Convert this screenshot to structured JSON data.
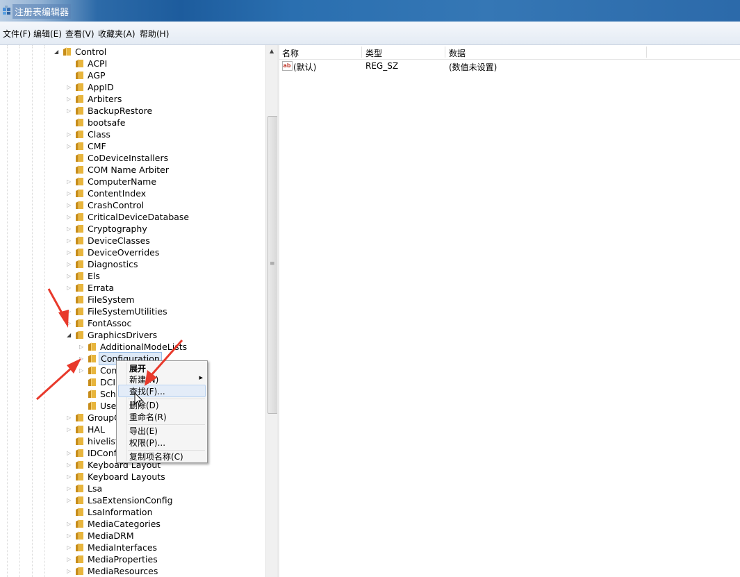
{
  "window": {
    "title": "注册表编辑器"
  },
  "menu": [
    "文件(F)",
    "编辑(E)",
    "查看(V)",
    "收藏夹(A)",
    "帮助(H)"
  ],
  "tree": {
    "rows": [
      {
        "label": "Control",
        "level": 0,
        "expander": "open"
      },
      {
        "label": "ACPI",
        "level": 1,
        "expander": "none"
      },
      {
        "label": "AGP",
        "level": 1,
        "expander": "none"
      },
      {
        "label": "AppID",
        "level": 1,
        "expander": "closed"
      },
      {
        "label": "Arbiters",
        "level": 1,
        "expander": "closed"
      },
      {
        "label": "BackupRestore",
        "level": 1,
        "expander": "closed"
      },
      {
        "label": "bootsafe",
        "level": 1,
        "expander": "none"
      },
      {
        "label": "Class",
        "level": 1,
        "expander": "closed"
      },
      {
        "label": "CMF",
        "level": 1,
        "expander": "closed"
      },
      {
        "label": "CoDeviceInstallers",
        "level": 1,
        "expander": "none"
      },
      {
        "label": "COM Name Arbiter",
        "level": 1,
        "expander": "none"
      },
      {
        "label": "ComputerName",
        "level": 1,
        "expander": "closed"
      },
      {
        "label": "ContentIndex",
        "level": 1,
        "expander": "closed"
      },
      {
        "label": "CrashControl",
        "level": 1,
        "expander": "closed"
      },
      {
        "label": "CriticalDeviceDatabase",
        "level": 1,
        "expander": "closed"
      },
      {
        "label": "Cryptography",
        "level": 1,
        "expander": "closed"
      },
      {
        "label": "DeviceClasses",
        "level": 1,
        "expander": "closed"
      },
      {
        "label": "DeviceOverrides",
        "level": 1,
        "expander": "closed"
      },
      {
        "label": "Diagnostics",
        "level": 1,
        "expander": "closed"
      },
      {
        "label": "Els",
        "level": 1,
        "expander": "closed"
      },
      {
        "label": "Errata",
        "level": 1,
        "expander": "closed"
      },
      {
        "label": "FileSystem",
        "level": 1,
        "expander": "none"
      },
      {
        "label": "FileSystemUtilities",
        "level": 1,
        "expander": "closed"
      },
      {
        "label": "FontAssoc",
        "level": 1,
        "expander": "closed"
      },
      {
        "label": "GraphicsDrivers",
        "level": 1,
        "expander": "open"
      },
      {
        "label": "AdditionalModeLists",
        "level": 2,
        "expander": "closed"
      },
      {
        "label": "Configuration",
        "level": 2,
        "expander": "closed",
        "selected": true
      },
      {
        "label": "Conn",
        "level": 2,
        "expander": "closed"
      },
      {
        "label": "DCI",
        "level": 2,
        "expander": "none"
      },
      {
        "label": "Sche",
        "level": 2,
        "expander": "none"
      },
      {
        "label": "UseN",
        "level": 2,
        "expander": "none"
      },
      {
        "label": "GroupC",
        "level": 1,
        "expander": "closed"
      },
      {
        "label": "HAL",
        "level": 1,
        "expander": "closed"
      },
      {
        "label": "hivelist",
        "level": 1,
        "expander": "none"
      },
      {
        "label": "IDConfi",
        "level": 1,
        "expander": "closed"
      },
      {
        "label": "Keyboard Layout",
        "level": 1,
        "expander": "closed"
      },
      {
        "label": "Keyboard Layouts",
        "level": 1,
        "expander": "closed"
      },
      {
        "label": "Lsa",
        "level": 1,
        "expander": "closed"
      },
      {
        "label": "LsaExtensionConfig",
        "level": 1,
        "expander": "closed"
      },
      {
        "label": "LsaInformation",
        "level": 1,
        "expander": "none"
      },
      {
        "label": "MediaCategories",
        "level": 1,
        "expander": "closed"
      },
      {
        "label": "MediaDRM",
        "level": 1,
        "expander": "closed"
      },
      {
        "label": "MediaInterfaces",
        "level": 1,
        "expander": "closed"
      },
      {
        "label": "MediaProperties",
        "level": 1,
        "expander": "closed"
      },
      {
        "label": "MediaResources",
        "level": 1,
        "expander": "closed"
      }
    ]
  },
  "values": {
    "columns": [
      "名称",
      "类型",
      "数据"
    ],
    "rows": [
      {
        "name": "(默认)",
        "type": "REG_SZ",
        "data": "(数值未设置)",
        "icon": "string-value-icon"
      }
    ]
  },
  "context_menu": {
    "items": [
      {
        "label": "展开",
        "bold": true
      },
      {
        "label": "新建(N)",
        "submenu": true
      },
      {
        "label": "查找(F)...",
        "highlighted": true
      },
      {
        "label": "删除(D)"
      },
      {
        "label": "重命名(R)"
      },
      {
        "label": "导出(E)"
      },
      {
        "label": "权限(P)..."
      },
      {
        "label": "复制项名称(C)"
      }
    ]
  },
  "annotations": {
    "arrow_color": "#e8392b",
    "icons": [
      "red-arrow-icon"
    ]
  },
  "colors": {
    "folder": "#e8b53c",
    "selection": "#dde9f7"
  }
}
